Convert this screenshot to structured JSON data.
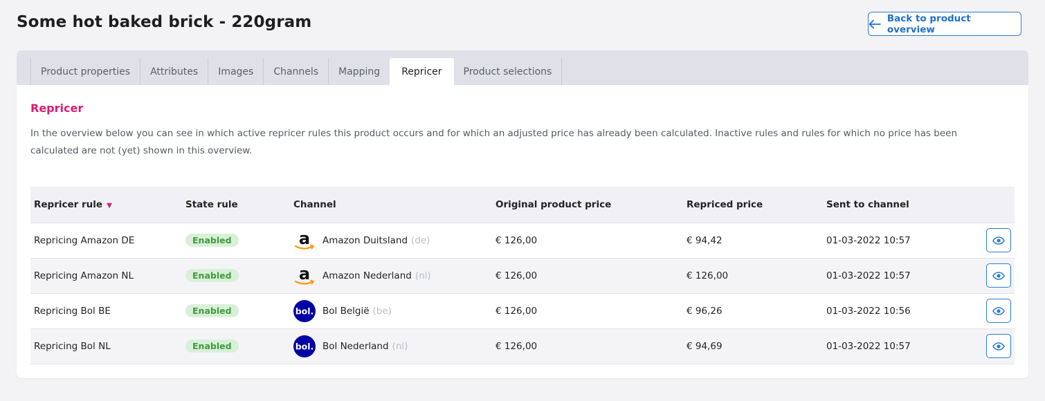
{
  "header": {
    "title": "Some hot baked brick - 220gram",
    "back_label": "Back to product overview"
  },
  "tabs": [
    {
      "label": "Product properties"
    },
    {
      "label": "Attributes"
    },
    {
      "label": "Images"
    },
    {
      "label": "Channels"
    },
    {
      "label": "Mapping"
    },
    {
      "label": "Repricer",
      "active": true
    },
    {
      "label": "Product selections"
    }
  ],
  "section": {
    "title": "Repricer",
    "intro": "In the overview below you can see in which active repricer rules this product occurs and for which an adjusted price has already been calculated. Inactive rules and rules for which no price has been calculated are not (yet) shown in this overview."
  },
  "table": {
    "columns": {
      "rule": "Repricer rule",
      "state": "State rule",
      "channel": "Channel",
      "original": "Original product price",
      "repriced": "Repriced price",
      "sent": "Sent to channel"
    },
    "rows": [
      {
        "rule": "Repricing Amazon DE",
        "state": "Enabled",
        "channel": "Amazon Duitsland",
        "lang": "(de)",
        "logo": "amazon-logo",
        "original": "€ 126,00",
        "repriced": "€ 94,42",
        "sent": "01-03-2022 10:57"
      },
      {
        "rule": "Repricing Amazon NL",
        "state": "Enabled",
        "channel": "Amazon Nederland",
        "lang": "(nl)",
        "logo": "amazon-logo",
        "original": "€ 126,00",
        "repriced": "€ 126,00",
        "sent": "01-03-2022 10:57"
      },
      {
        "rule": "Repricing Bol BE",
        "state": "Enabled",
        "channel": "Bol België",
        "lang": "(be)",
        "logo": "bol-logo",
        "original": "€ 126,00",
        "repriced": "€ 96,26",
        "sent": "01-03-2022 10:56"
      },
      {
        "rule": "Repricing Bol NL",
        "state": "Enabled",
        "channel": "Bol Nederland",
        "lang": "(nl)",
        "logo": "bol-logo",
        "original": "€ 126,00",
        "repriced": "€ 94,69",
        "sent": "01-03-2022 10:57"
      }
    ]
  },
  "logos": {
    "amazon_text": "a",
    "bol_text": "bol."
  },
  "colors": {
    "accent": "#d81b74",
    "primary": "#2a7bd6",
    "badge_bg": "#d8f0d8",
    "badge_text": "#3f9b3f",
    "bol_blue": "#0000a4",
    "amazon_orange": "#ff9900"
  }
}
